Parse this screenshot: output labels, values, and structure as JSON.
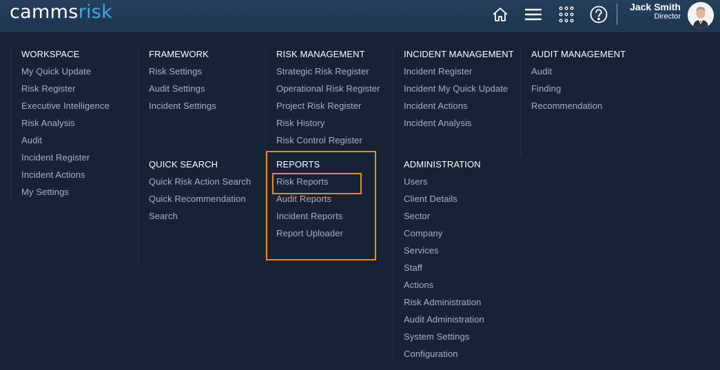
{
  "header": {
    "logo_part1": "camms",
    "logo_part2": "risk",
    "user_name": "Jack Smith",
    "user_role": "Director",
    "icons": [
      "home-icon",
      "menu-icon",
      "apps-grid-icon",
      "help-icon"
    ]
  },
  "colors": {
    "background": "#152335",
    "header": "#253f5c",
    "logo_accent": "#3fa9e0",
    "link": "#a5b2c1",
    "highlight": "#f08a1c"
  },
  "workspace": {
    "title": "WORKSPACE",
    "items": [
      "My Quick Update",
      "Risk Register",
      "Executive Intelligence",
      "Risk Analysis",
      "Audit",
      "Incident Register",
      "Incident Actions",
      "My Settings"
    ]
  },
  "framework": {
    "title": "FRAMEWORK",
    "items": [
      "Risk Settings",
      "Audit Settings",
      "Incident Settings"
    ]
  },
  "quick_search": {
    "title": "QUICK SEARCH",
    "items": [
      "Quick Risk Action Search",
      "Quick Recommendation",
      "Search"
    ]
  },
  "risk_management": {
    "title": "RISK MANAGEMENT",
    "items": [
      "Strategic Risk Register",
      "Operational Risk Register",
      "Project Risk Register",
      "Risk History",
      "Risk Control Register"
    ]
  },
  "reports": {
    "title": "REPORTS",
    "items": [
      "Risk Reports",
      "Audit Reports",
      "Incident Reports",
      "Report Uploader"
    ]
  },
  "incident_management": {
    "title": "INCIDENT MANAGEMENT",
    "items": [
      "Incident Register",
      "Incident My Quick Update",
      "Incident Actions",
      "Incident Analysis"
    ]
  },
  "administration": {
    "title": "ADMINISTRATION",
    "items": [
      "Users",
      "Client Details",
      "Sector",
      "Company",
      "Services",
      "Staff",
      "Actions",
      "Risk Administration",
      "Audit Administration",
      "System Settings",
      "Configuration"
    ]
  },
  "audit_management": {
    "title": "AUDIT MANAGEMENT",
    "items": [
      "Audit",
      "Finding",
      "Recommendation"
    ]
  }
}
